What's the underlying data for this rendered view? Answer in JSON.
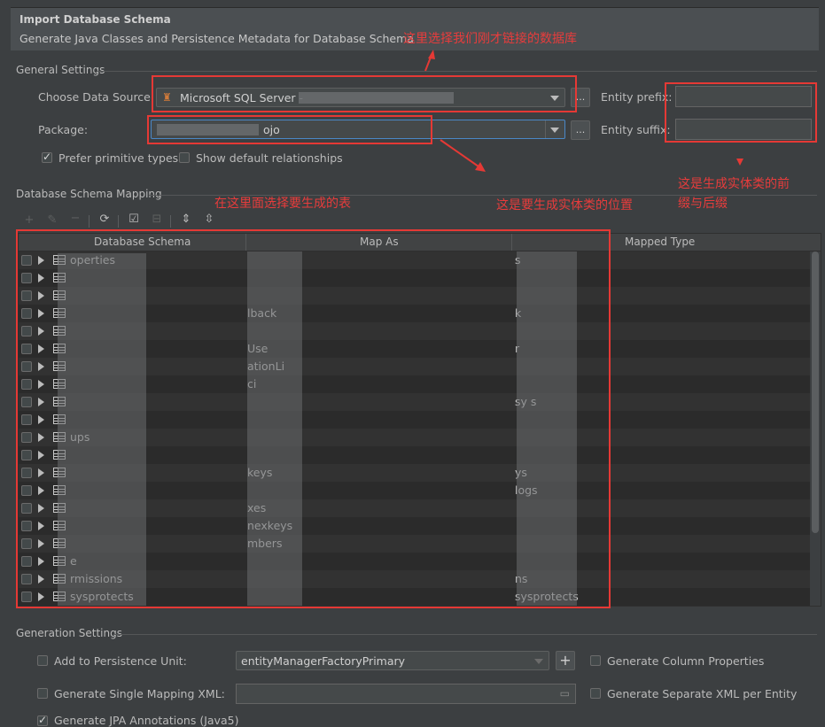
{
  "dialog": {
    "title": "Import Database Schema",
    "subtitle": "Generate Java Classes and Persistence Metadata for Database Schema"
  },
  "general": {
    "section_title": "General Settings",
    "data_source_label": "Choose Data Source:",
    "data_source_value": "Microsoft SQL Server - ",
    "browse_label": "...",
    "package_label": "Package:",
    "package_value": "ojo",
    "entity_prefix_label": "Entity prefix:",
    "entity_suffix_label": "Entity suffix:",
    "prefer_primitive_label": "Prefer primitive types",
    "prefer_primitive_checked": true,
    "show_default_rel_label": "Show default relationships",
    "show_default_rel_checked": false
  },
  "mapping": {
    "section_title": "Database Schema Mapping",
    "columns": [
      "Database Schema",
      "Map As",
      "Mapped Type"
    ],
    "rows": [
      {
        "name": "operties",
        "map": "",
        "type": "s"
      },
      {
        "name": "",
        "map": "",
        "type": ""
      },
      {
        "name": "",
        "map": "",
        "type": ""
      },
      {
        "name": "",
        "map": "lback",
        "type": "k"
      },
      {
        "name": "",
        "map": "",
        "type": ""
      },
      {
        "name": "",
        "map": "Use",
        "type": "r"
      },
      {
        "name": "",
        "map": "ationLi",
        "type": ""
      },
      {
        "name": "",
        "map": "ci",
        "type": ""
      },
      {
        "name": "",
        "map": "",
        "type": "sy          s"
      },
      {
        "name": "",
        "map": "",
        "type": ""
      },
      {
        "name": "ups",
        "map": "",
        "type": ""
      },
      {
        "name": "",
        "map": "",
        "type": ""
      },
      {
        "name": "",
        "map": "keys",
        "type": "ys"
      },
      {
        "name": "",
        "map": "",
        "type": "logs"
      },
      {
        "name": "",
        "map": "xes",
        "type": ""
      },
      {
        "name": "",
        "map": "nexkeys",
        "type": ""
      },
      {
        "name": "",
        "map": "mbers",
        "type": ""
      },
      {
        "name": "e",
        "map": "",
        "type": ""
      },
      {
        "name": "rmissions",
        "map": "",
        "type": "ns"
      },
      {
        "name": "sysprotects",
        "map": "",
        "type": "sysprotects"
      }
    ]
  },
  "generation": {
    "section_title": "Generation Settings",
    "add_persistence_label": "Add to Persistence Unit:",
    "persistence_unit_value": "entityManagerFactoryPrimary",
    "add_button": "+",
    "generate_column_props_label": "Generate Column Properties",
    "single_mapping_label": "Generate Single Mapping XML:",
    "separate_xml_label": "Generate Separate XML per Entity",
    "jpa_annotations_label": "Generate JPA Annotations (Java5)"
  },
  "annotations": {
    "datasource_note": "这里选择我们刚才链接的数据库",
    "prefix_suffix_note_1": "这是生成实体类的前",
    "prefix_suffix_note_2": "缀与后缀",
    "table_note": "在这里面选择要生成的表",
    "package_note": "这是要生成实体类的位置",
    "color": "#e53935"
  },
  "colors": {
    "background": "#3c3f41",
    "focus_border": "#4a88c7"
  }
}
